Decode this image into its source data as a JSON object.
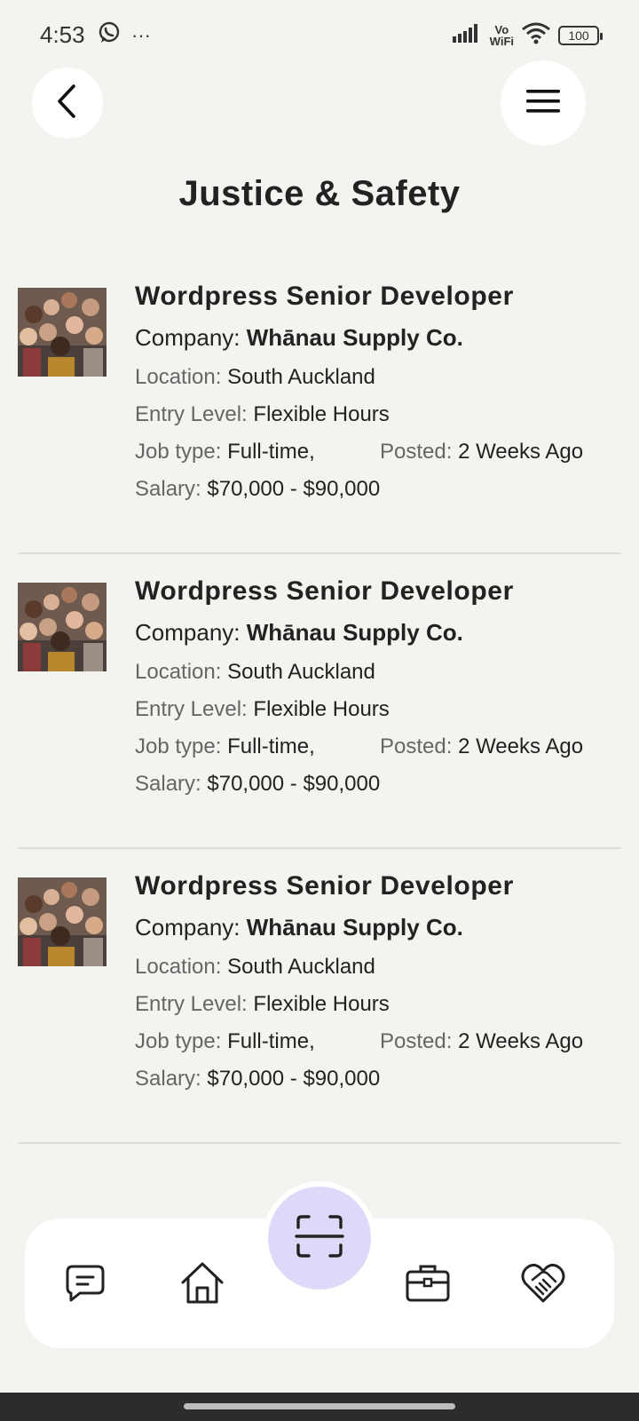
{
  "status_bar": {
    "time": "4:53",
    "more": "···",
    "vo": "Vo",
    "wifi_label": "WiFi",
    "battery": "100",
    "icons": [
      "whatsapp-icon",
      "signal-icon",
      "wifi-icon",
      "battery-icon"
    ]
  },
  "header": {
    "title": "Justice & Safety",
    "back_icon": "chevron-left-icon",
    "menu_icon": "hamburger-menu-icon"
  },
  "jobs": [
    {
      "title": "Wordpress Senior Developer",
      "company_label": "Company:",
      "company": "Whānau Supply Co.",
      "location_label": "Location:",
      "location": "South Auckland",
      "entry_label": "Entry Level:",
      "entry": "Flexible Hours",
      "jobtype_label": "Job type:",
      "jobtype": "Full-time,",
      "posted_label": "Posted:",
      "posted": "2 Weeks Ago",
      "salary_label": "Salary:",
      "salary": "$70,000 - $90,000"
    },
    {
      "title": "Wordpress Senior Developer",
      "company_label": "Company:",
      "company": "Whānau Supply Co.",
      "location_label": "Location:",
      "location": "South Auckland",
      "entry_label": "Entry Level:",
      "entry": "Flexible Hours",
      "jobtype_label": "Job type:",
      "jobtype": "Full-time,",
      "posted_label": "Posted:",
      "posted": "2 Weeks Ago",
      "salary_label": "Salary:",
      "salary": "$70,000 - $90,000"
    },
    {
      "title": "Wordpress Senior Developer",
      "company_label": "Company:",
      "company": "Whānau Supply Co.",
      "location_label": "Location:",
      "location": "South Auckland",
      "entry_label": "Entry Level:",
      "entry": "Flexible Hours",
      "jobtype_label": "Job type:",
      "jobtype": "Full-time,",
      "posted_label": "Posted:",
      "posted": "2 Weeks Ago",
      "salary_label": "Salary:",
      "salary": "$70,000 - $90,000"
    }
  ],
  "bottom_nav": {
    "items": [
      "chat-icon",
      "home-icon",
      "scan-icon",
      "briefcase-icon",
      "handshake-heart-icon"
    ],
    "scan_accent": "#dcdaf8"
  },
  "colors": {
    "background": "#f3f3ef",
    "card": "#ffffff",
    "text": "#222222",
    "label": "#666666"
  }
}
